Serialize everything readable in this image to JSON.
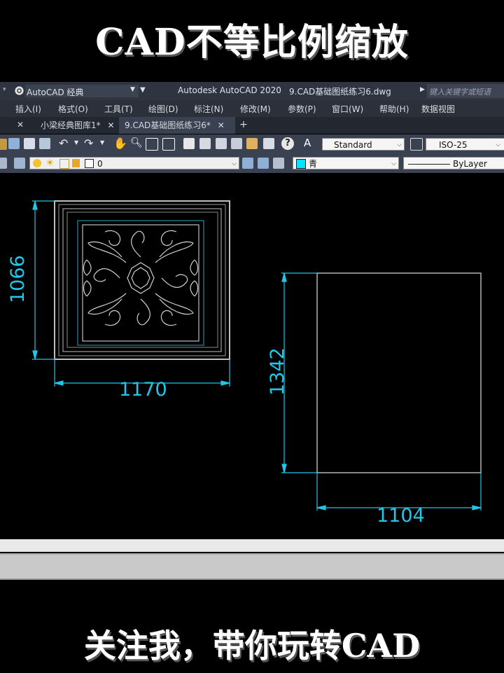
{
  "overlay": {
    "top_title": "CAD不等比例缩放",
    "bottom_caption": "关注我，带你玩转CAD"
  },
  "titlebar": {
    "workspace": "AutoCAD 经典",
    "app_title": "Autodesk AutoCAD 2020",
    "file_name": "9.CAD基础图纸练习6.dwg",
    "search_placeholder": "键入关键字或短语"
  },
  "menu": [
    "插入(I)",
    "格式(O)",
    "工具(T)",
    "绘图(D)",
    "标注(N)",
    "修改(M)",
    "参数(P)",
    "窗口(W)",
    "帮助(H)",
    "数据视图"
  ],
  "tabs": [
    {
      "label": "小梁经典图库1*",
      "close": "✕"
    },
    {
      "label": "9.CAD基础图纸练习6*",
      "close": "✕",
      "active": true
    }
  ],
  "tab_close_first": "✕",
  "tab_add": "+",
  "toolbar": {
    "text_style": "Standard",
    "dim_style": "ISO-25",
    "layer": "0",
    "color": "青",
    "linetype": "ByLayer",
    "help_glyph": "?"
  },
  "drawing": {
    "dimensions": [
      "1066",
      "1170",
      "1342",
      "1104"
    ],
    "colors": {
      "dimension": "#1fc7e8",
      "outline": "#cfcfcf"
    }
  }
}
